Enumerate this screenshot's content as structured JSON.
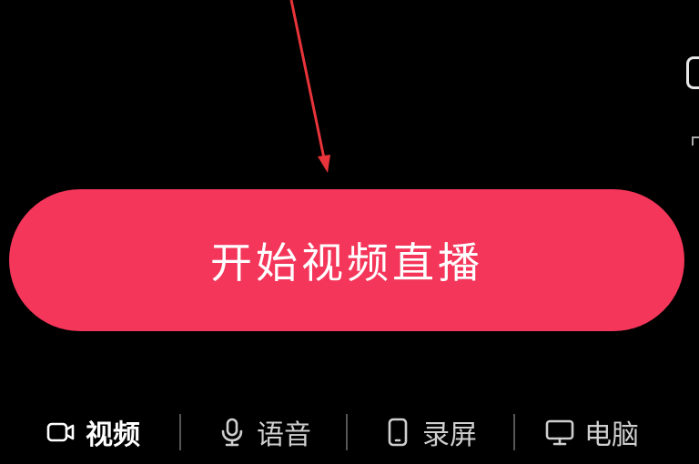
{
  "primary_action": {
    "label": "开始视频直播",
    "color": "#f4365a"
  },
  "annotation": {
    "arrow_color": "#e8343a"
  },
  "modes": [
    {
      "label": "视频",
      "icon": "video-camera-icon",
      "active": true
    },
    {
      "label": "语音",
      "icon": "microphone-icon",
      "active": false
    },
    {
      "label": "录屏",
      "icon": "phone-screen-icon",
      "active": false
    },
    {
      "label": "电脑",
      "icon": "monitor-icon",
      "active": false
    }
  ]
}
